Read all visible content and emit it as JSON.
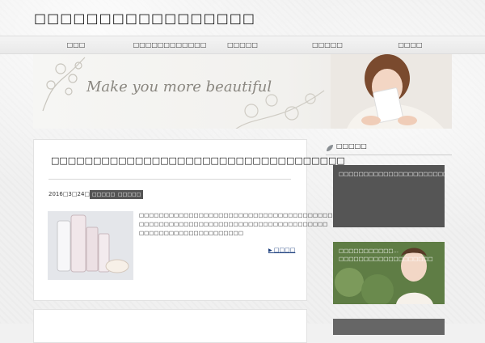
{
  "site": {
    "title": "□□□□□□□□□□□□□□□□□"
  },
  "nav": {
    "items": [
      {
        "label": "□□□"
      },
      {
        "label": "□□□□□□□□□□□□"
      },
      {
        "label": "□□□□□"
      },
      {
        "label": "□□□□□"
      },
      {
        "label": "□□□□"
      }
    ]
  },
  "hero": {
    "tagline": "Make you more beautiful"
  },
  "post": {
    "title": "□□□□□□□□□□□□□□□□□□□□□□□□□□□□□□□□□□□",
    "date": "2016□3□24□",
    "categories": [
      "□□□□□",
      "□□□□□"
    ],
    "excerpt": "□□□□□□□□□□□□□□□□□□□□□□□□□□□□□□□□□□□□□□□□□2 □□□□□□□□□□□□□□□□□□□□□□□□□□□□□□□□□□□□□□ □□□□□□□□□□□□□□□□□□□□□",
    "more": "□□□□"
  },
  "sidebar": {
    "heading": "□□□□□",
    "items": [
      {
        "label": "□□□□□□□□□□□□□□□□□□□□□□□□□□□"
      },
      {
        "label": "□□□□□□□□□□□…□□□□□□□□□□□□□□□□□□□"
      },
      {
        "label": ""
      }
    ]
  }
}
